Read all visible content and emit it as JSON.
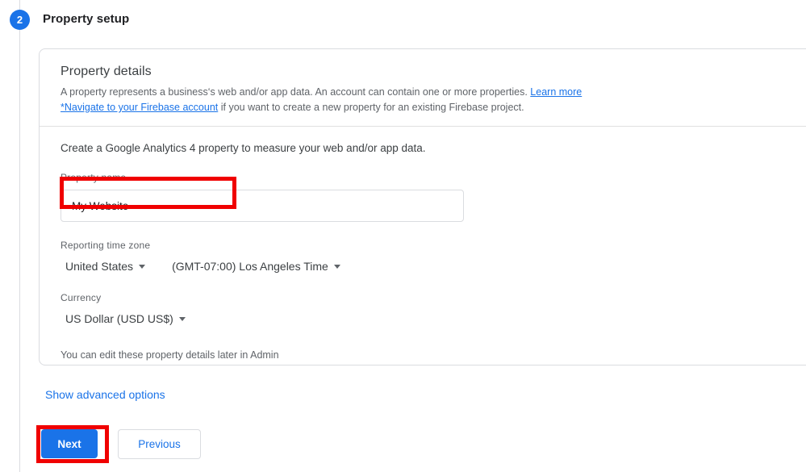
{
  "stepper": {
    "step_number": "2",
    "step_title": "Property setup"
  },
  "card": {
    "title": "Property details",
    "description_line1_text": "A property represents a business‘s web and/or app data. An account can contain one or more properties. ",
    "description_learn_more_link": "Learn more",
    "description_firebase_link": "*Navigate to your Firebase account",
    "description_line2_text": " if you want to create a new property for an existing Firebase project.",
    "measure_text": "Create a Google Analytics 4 property to measure your web and/or app data.",
    "edit_note": "You can edit these property details later in Admin"
  },
  "fields": {
    "property_name": {
      "label": "Property name",
      "value": "My Website",
      "placeholder": ""
    },
    "reporting_time_zone": {
      "label": "Reporting time zone",
      "country_value": "United States",
      "zone_value": "(GMT-07:00) Los Angeles Time"
    },
    "currency": {
      "label": "Currency",
      "value": "US Dollar (USD US$)"
    }
  },
  "links": {
    "show_advanced_options": "Show advanced options"
  },
  "buttons": {
    "next": "Next",
    "previous": "Previous"
  },
  "colors": {
    "accent_blue": "#1a73e8",
    "annotation_red": "#f00000",
    "border_gray": "#dadce0",
    "text_primary": "#202124",
    "text_secondary": "#5f6368"
  }
}
